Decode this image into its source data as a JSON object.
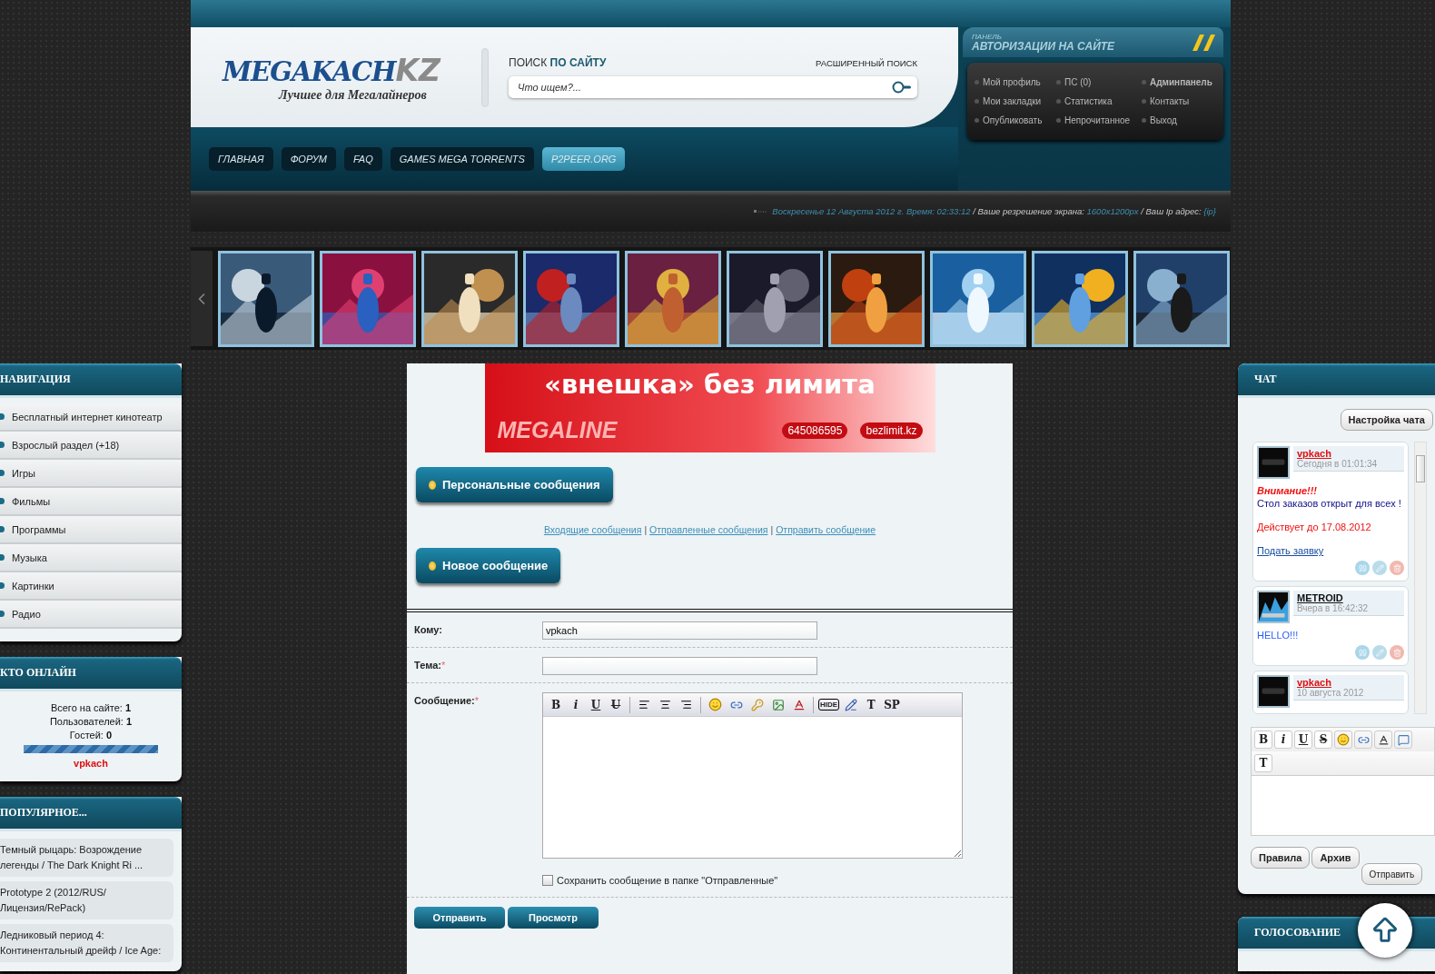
{
  "header": {
    "logo": "MEGAKACH",
    "logo_suffix": "KZ",
    "tagline": "Лучшее для Мегалайнеров",
    "search": {
      "title": "ПОИСК",
      "title_accent": "ПО САЙТУ",
      "advanced": "РАСШИРЕННЫЙ ПОИСК",
      "placeholder": "Что ищем?..."
    },
    "nav": [
      {
        "label": "ГЛАВНАЯ",
        "selected": false
      },
      {
        "label": "ФОРУМ",
        "selected": false
      },
      {
        "label": "FAQ",
        "selected": false
      },
      {
        "label": "GAMES MEGA TORRENTS",
        "selected": false
      },
      {
        "label": "P2PEER.ORG",
        "selected": true
      }
    ],
    "auth": {
      "title_small": "ПАНЕЛЬ",
      "title": "АВТОРИЗАЦИИ НА САЙТЕ",
      "links": [
        {
          "label": "Мой профиль",
          "bold": false
        },
        {
          "label": "ПС (0)",
          "bold": false
        },
        {
          "label": "Админпанель",
          "bold": true
        },
        {
          "label": "Мои закладки",
          "bold": false
        },
        {
          "label": "Статистика",
          "bold": false
        },
        {
          "label": "Контакты",
          "bold": false
        },
        {
          "label": "Опубликовать",
          "bold": false
        },
        {
          "label": "Непрочитанное",
          "bold": false
        },
        {
          "label": "Выход",
          "bold": false
        }
      ]
    },
    "info": [
      {
        "text": "Воскресенье 12 Августа 2012 г. Время: 02:33:12",
        "highlight": true
      },
      {
        "text": " / Ваше резрешение экрана: ",
        "highlight": false
      },
      {
        "text": "1600x1200px",
        "highlight": true
      },
      {
        "text": " / Ваш Ip адрес: ",
        "highlight": false
      },
      {
        "text": "{ip}",
        "highlight": true
      }
    ]
  },
  "left": {
    "navigation": {
      "title": "НАВИГАЦИЯ",
      "items": [
        "Бесплатный интернет кинотеатр",
        "Взрослый раздел (+18)",
        "Игры",
        "Фильмы",
        "Программы",
        "Музыка",
        "Картинки",
        "Радио"
      ]
    },
    "online": {
      "title": "КТО ОНЛАЙН",
      "stats": [
        "Всего на сайте: **1**",
        "Пользователей: **1**",
        "Гостей: **0**"
      ],
      "user": "vpkach"
    },
    "popular": {
      "title": "ПОПУЛЯРНОЕ...",
      "items": [
        "Темный рыцарь: Возрождение легенды / The Dark Knight Ri ...",
        "Prototype 2 (2012/RUS/ Лицензия/RePack)",
        "Ледниковый период 4: Континентальный дрейф / Ice Age:"
      ]
    }
  },
  "center": {
    "banner": {
      "headline": "«внешка» без лимита",
      "brand": "MEGALINE",
      "phone": "645086595",
      "site": "bezlimit.kz"
    },
    "pm_title": "Персональные сообщения",
    "links": [
      {
        "kind": "link",
        "text": "Входящие сообщения"
      },
      {
        "kind": "separator",
        "text": "|"
      },
      {
        "kind": "link",
        "text": "Отправленные сообщения"
      },
      {
        "kind": "separator",
        "text": "|"
      },
      {
        "kind": "link",
        "text": "Отправить сообщение"
      }
    ],
    "new_title": "Новое сообщение",
    "form": {
      "to": {
        "label": "Кому:",
        "value": "vpkach"
      },
      "subject": {
        "label": "Тема:",
        "mark": "*"
      },
      "message": {
        "label": "Сообщение:",
        "mark": "*"
      },
      "toolbar": [
        {
          "kind": "text",
          "label": "B"
        },
        {
          "kind": "text",
          "label": "i"
        },
        {
          "kind": "text",
          "label": "U"
        },
        {
          "kind": "text",
          "label": "U"
        },
        {
          "kind": "separator"
        },
        {
          "kind": "icon"
        },
        {
          "kind": "icon"
        },
        {
          "kind": "icon"
        },
        {
          "kind": "separator"
        },
        {
          "kind": "icon"
        },
        {
          "kind": "icon"
        },
        {
          "kind": "icon"
        },
        {
          "kind": "icon"
        },
        {
          "kind": "icon"
        },
        {
          "kind": "separator"
        },
        {
          "kind": "text",
          "label": "HIDE"
        },
        {
          "kind": "icon"
        },
        {
          "kind": "text",
          "label": "T"
        },
        {
          "kind": "text",
          "label": "SP"
        }
      ],
      "save": {
        "label": "Сохранить сообщение в папке \"Отправленные\"",
        "checked": false
      },
      "buttons": [
        "Отправить",
        "Просмотр"
      ]
    }
  },
  "chat": {
    "title": "ЧАТ",
    "settings": "Настройка чата",
    "messages": [
      {
        "author": "vpkach",
        "color": "#e01010",
        "time": "Сегодня в 01:01:34",
        "lines": [
          {
            "kind": "alert",
            "text": "Внимание!!!"
          },
          {
            "kind": "text",
            "text": "Стол заказов открыт для всех !"
          },
          {
            "kind": "gap"
          },
          {
            "kind": "notice",
            "text": "Действует до 17.08.2012"
          },
          {
            "kind": "gap"
          },
          {
            "kind": "link",
            "text": "Подать заявку"
          }
        ]
      },
      {
        "author": "METROID",
        "color": "#111111",
        "time": "Вчера в 16:42:32",
        "lines": [
          {
            "kind": "hello",
            "text": "HELLO!!!"
          }
        ]
      },
      {
        "author": "vpkach",
        "color": "#e01010",
        "time": "10 августа 2012"
      }
    ],
    "toolbar": [
      {
        "kind": "text",
        "label": "B"
      },
      {
        "kind": "text",
        "label": "i"
      },
      {
        "kind": "text",
        "label": "U"
      },
      {
        "kind": "text",
        "label": "S"
      },
      {
        "kind": "icon"
      },
      {
        "kind": "icon"
      },
      {
        "kind": "icon"
      },
      {
        "kind": "icon"
      }
    ],
    "toolbar2": [
      {
        "kind": "text",
        "label": "T"
      }
    ],
    "buttons": [
      "Правила",
      "Архив"
    ],
    "send": "Отправить"
  },
  "voting": {
    "title": "ГОЛОСОВАНИЕ"
  }
}
